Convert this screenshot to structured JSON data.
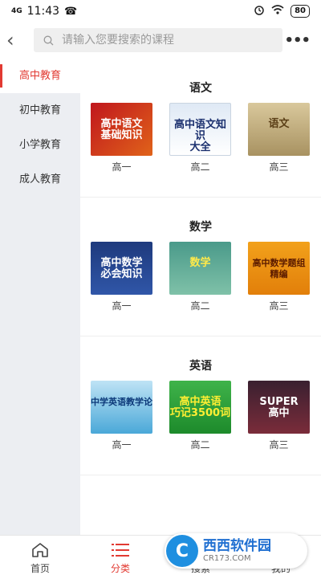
{
  "status": {
    "network": "4G",
    "time": "11:43",
    "battery": "80"
  },
  "search": {
    "placeholder": "请输入您要搜索的课程"
  },
  "sidebar": {
    "items": [
      {
        "label": "高中教育",
        "active": true
      },
      {
        "label": "初中教育",
        "active": false
      },
      {
        "label": "小学教育",
        "active": false
      },
      {
        "label": "成人教育",
        "active": false
      }
    ]
  },
  "sections": [
    {
      "title": "语文",
      "books": [
        {
          "grade": "高一",
          "cover_text": "高中语文\n基础知识"
        },
        {
          "grade": "高二",
          "cover_text": "高中语文知识\n大全"
        },
        {
          "grade": "高三",
          "cover_text": "语文"
        }
      ]
    },
    {
      "title": "数学",
      "books": [
        {
          "grade": "高一",
          "cover_text": "高中数学\n必会知识"
        },
        {
          "grade": "高二",
          "cover_text": "数学"
        },
        {
          "grade": "高三",
          "cover_text": "高中数学题组\n精编"
        }
      ]
    },
    {
      "title": "英语",
      "books": [
        {
          "grade": "高一",
          "cover_text": "中学英语教学论"
        },
        {
          "grade": "高二",
          "cover_text": "高中英语\n巧记3500词"
        },
        {
          "grade": "高三",
          "cover_text": "SUPER\n高中"
        }
      ]
    }
  ],
  "tabbar": [
    {
      "label": "首页",
      "icon": "home-icon",
      "active": false
    },
    {
      "label": "分类",
      "icon": "list-icon",
      "active": true
    },
    {
      "label": "搜索",
      "icon": "search-icon",
      "active": false
    },
    {
      "label": "我的",
      "icon": "user-icon",
      "active": false
    }
  ],
  "watermark": {
    "logo": "C",
    "main": "西西软件园",
    "sub": "CR173.COM"
  },
  "colors": {
    "accent": "#e23a32",
    "sidebar_bg": "#eceef2"
  }
}
